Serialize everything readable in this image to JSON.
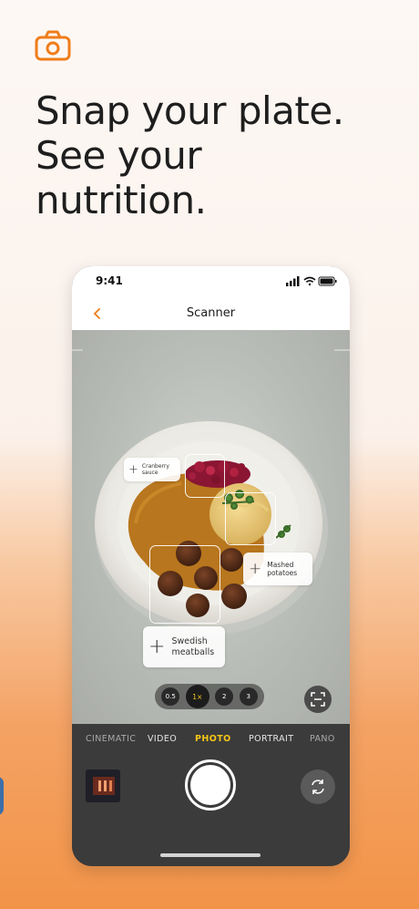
{
  "colors": {
    "accent": "#ef7d1a",
    "shutter_active": "#f5c518"
  },
  "app_icon": "camera-icon",
  "headline": {
    "line1": "Snap your plate.",
    "line2": "See your",
    "line3": "nutrition."
  },
  "phone": {
    "status_bar": {
      "time": "9:41",
      "icons": [
        "signal-icon",
        "wifi-icon",
        "battery-icon"
      ]
    },
    "nav": {
      "back_icon": "chevron-left-icon",
      "title": "Scanner"
    },
    "food_tags": [
      {
        "label": "Cranberry\nsauce",
        "icon": "plus-icon"
      },
      {
        "label": "Mashed\npotatoes",
        "icon": "plus-icon"
      },
      {
        "label": "Swedish\nmeatballs",
        "icon": "plus-icon"
      }
    ],
    "zoom": {
      "options": [
        "0.5",
        "1×",
        "2",
        "3"
      ],
      "selected": "1×"
    },
    "scan_icon": "scan-frame-icon",
    "modes": [
      "CINEMATIC",
      "VIDEO",
      "PHOTO",
      "PORTRAIT",
      "PANO"
    ],
    "selected_mode": "PHOTO",
    "flip_icon": "camera-flip-icon"
  }
}
